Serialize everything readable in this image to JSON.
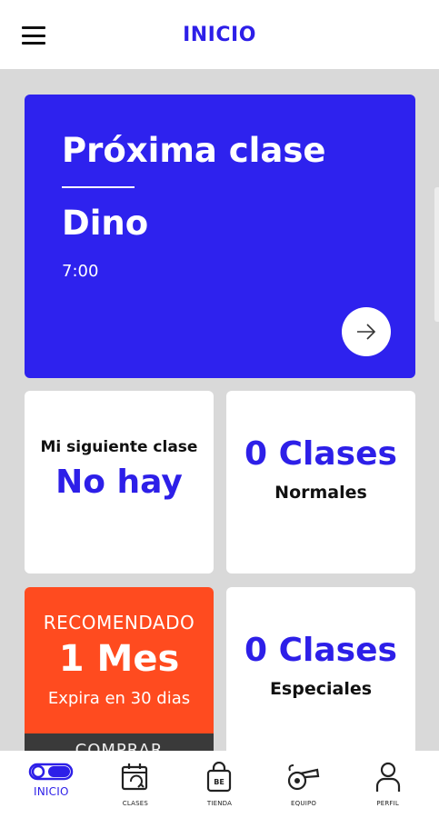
{
  "header": {
    "title": "INICIO"
  },
  "next_class": {
    "title": "Próxima clase",
    "name": "Dino",
    "time": "7:00"
  },
  "tiles": {
    "next": {
      "label": "Mi siguiente clase",
      "value": "No hay"
    },
    "normal": {
      "count": "0 Clases",
      "label": "Normales"
    },
    "promo": {
      "top": "RECOMENDADO",
      "main": "1 Mes",
      "sub": "Expira en 30 dias",
      "buy": "COMPRAR"
    },
    "special": {
      "count": "0 Clases",
      "label": "Especiales"
    }
  },
  "tabs": [
    {
      "label": "INICIO",
      "icon": "home-toggle-icon",
      "active": true
    },
    {
      "label": "CLASES",
      "icon": "calendar-icon",
      "active": false
    },
    {
      "label": "TIENDA",
      "icon": "shopping-bag-icon",
      "active": false
    },
    {
      "label": "EQUIPO",
      "icon": "whistle-icon",
      "active": false
    },
    {
      "label": "PERFIL",
      "icon": "user-icon",
      "active": false
    }
  ],
  "colors": {
    "accent_blue": "#2e22ee",
    "promo_orange": "#ff4b1f",
    "background": "#d9d9d9"
  }
}
